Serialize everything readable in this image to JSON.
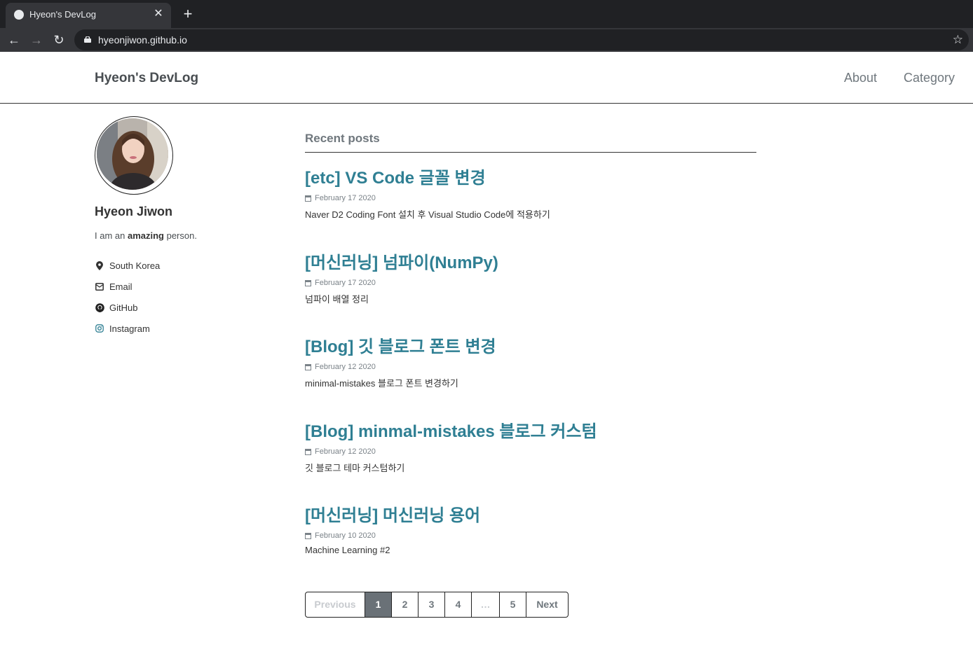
{
  "browser": {
    "tab_title": "Hyeon's DevLog",
    "url": "hyeonjiwon.github.io"
  },
  "site": {
    "title": "Hyeon's DevLog",
    "nav": [
      "About",
      "Category"
    ]
  },
  "author": {
    "name": "Hyeon Jiwon",
    "bio_prefix": "I am an ",
    "bio_bold": "amazing",
    "bio_suffix": " person.",
    "links": [
      {
        "label": "South Korea",
        "icon": "location-icon"
      },
      {
        "label": "Email",
        "icon": "email-icon"
      },
      {
        "label": "GitHub",
        "icon": "github-icon"
      },
      {
        "label": "Instagram",
        "icon": "instagram-icon"
      }
    ]
  },
  "recent": {
    "heading": "Recent posts",
    "posts": [
      {
        "title": "[etc] VS Code 글꼴 변경",
        "date": "February 17 2020",
        "excerpt": "Naver D2 Coding Font 설치 후 Visual Studio Code에 적용하기"
      },
      {
        "title": "[머신러닝] 넘파이(NumPy)",
        "date": "February 17 2020",
        "excerpt": "넘파이 배열 정리"
      },
      {
        "title": "[Blog] 깃 블로그 폰트 변경",
        "date": "February 12 2020",
        "excerpt": "minimal-mistakes 블로그 폰트 변경하기"
      },
      {
        "title": "[Blog] minmal-mistakes 블로그 커스텀",
        "date": "February 12 2020",
        "excerpt": "깃 블로그 테마 커스텀하기"
      },
      {
        "title": "[머신러닝] 머신러닝 용어",
        "date": "February 10 2020",
        "excerpt": "Machine Learning #2"
      }
    ]
  },
  "pagination": {
    "previous": "Previous",
    "pages": [
      "1",
      "2",
      "3",
      "4"
    ],
    "ellipsis": "…",
    "last": "5",
    "next": "Next",
    "current": "1"
  },
  "colors": {
    "link": "#2f7f93",
    "chrome_dark": "#202124",
    "active_page": "#6a7177"
  }
}
